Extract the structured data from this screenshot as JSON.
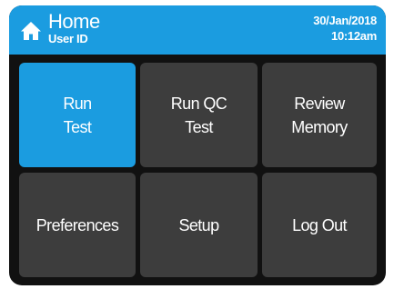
{
  "header": {
    "title": "Home",
    "subtitle": "User ID",
    "date": "30/Jan/2018",
    "time": "10:12am",
    "home_icon": "home-icon"
  },
  "colors": {
    "accent": "#1b9ce0",
    "tile": "#3d3d3d",
    "bezel": "#111111",
    "text": "#ffffff"
  },
  "menu": {
    "run_test": "Run\nTest",
    "run_qc_test": "Run QC\nTest",
    "review_memory": "Review\nMemory",
    "preferences": "Preferences",
    "setup": "Setup",
    "log_out": "Log Out"
  },
  "selected_tile": "run_test"
}
